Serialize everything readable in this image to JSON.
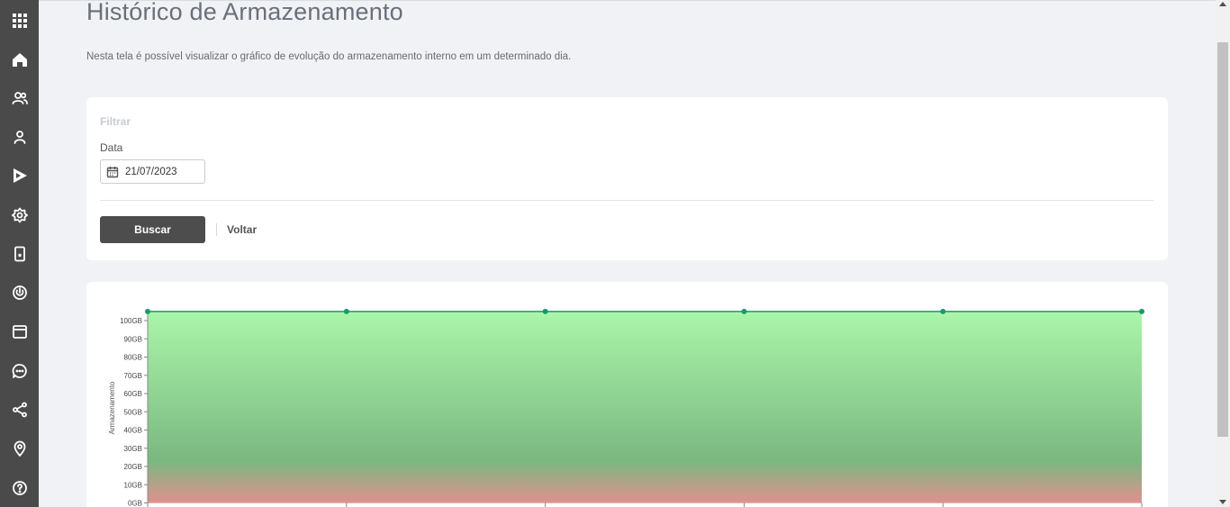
{
  "sidebar": {
    "items": [
      {
        "name": "apps-grid-icon"
      },
      {
        "name": "home-icon"
      },
      {
        "name": "users-icon"
      },
      {
        "name": "user-icon"
      },
      {
        "name": "play-icon"
      },
      {
        "name": "settings-icon"
      },
      {
        "name": "device-icon"
      },
      {
        "name": "power-icon"
      },
      {
        "name": "calendar-icon"
      },
      {
        "name": "chat-icon"
      },
      {
        "name": "share-icon"
      },
      {
        "name": "location-icon"
      },
      {
        "name": "help-icon"
      }
    ]
  },
  "header": {
    "title": "Histórico de Armazenamento",
    "description": "Nesta tela é possível visualizar o gráfico de evolução do armazenamento interno em um determinado dia."
  },
  "filter": {
    "title": "Filtrar",
    "date_label": "Data",
    "date_value": "21/07/2023",
    "search_label": "Buscar",
    "back_label": "Voltar"
  },
  "colors": {
    "sidebar_bg": "#4a4a4a",
    "line": "#1a9a6c",
    "fill_top": "#a6f5a6",
    "fill_mid": "#74b47a",
    "fill_bottom": "#e08a8a",
    "button_bg": "#4d4d4d"
  },
  "chart_data": {
    "type": "area",
    "ylabel": "Armazenamento",
    "xlabel": "",
    "ylim": [
      0,
      100
    ],
    "yticks": [
      "0GB",
      "10GB",
      "20GB",
      "30GB",
      "40GB",
      "50GB",
      "60GB",
      "70GB",
      "80GB",
      "90GB",
      "100GB"
    ],
    "ytick_values": [
      0,
      10,
      20,
      30,
      40,
      50,
      60,
      70,
      80,
      90,
      100
    ],
    "series": [
      {
        "values": [
          105,
          105,
          105,
          105,
          105,
          105
        ]
      }
    ],
    "x_count": 6,
    "grid": true
  }
}
